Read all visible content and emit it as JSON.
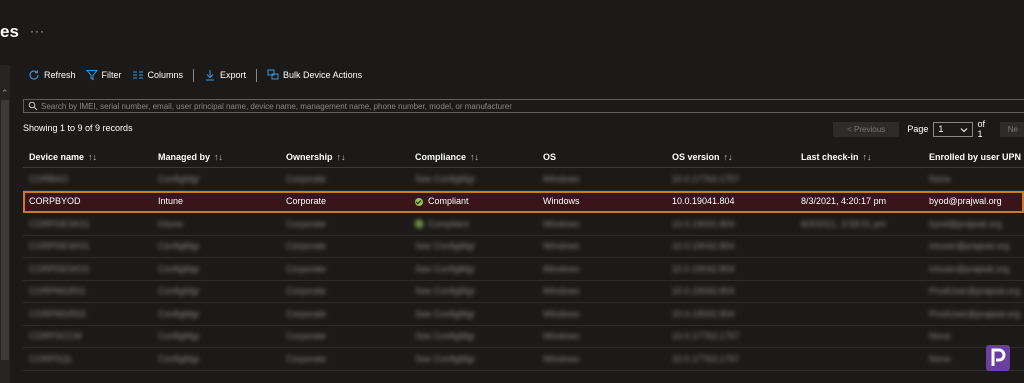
{
  "header": {
    "title": "es",
    "more": "···"
  },
  "toolbar": {
    "refresh": "Refresh",
    "filter": "Filter",
    "columns": "Columns",
    "export": "Export",
    "bulk": "Bulk Device Actions"
  },
  "search": {
    "placeholder": "Search by IMEI, serial number, email, user principal name, device name, management name, phone number, model, or manufacturer",
    "value": ""
  },
  "records": "Showing 1 to 9 of 9 records",
  "pager": {
    "previous": "< Previous",
    "page_label": "Page",
    "page_value": "1",
    "of_label": "of 1",
    "next": "Ne"
  },
  "columns": [
    {
      "label": "Device name",
      "sort": "↑↓"
    },
    {
      "label": "Managed by",
      "sort": "↑↓"
    },
    {
      "label": "Ownership",
      "sort": "↑↓"
    },
    {
      "label": "Compliance",
      "sort": "↑↓"
    },
    {
      "label": "OS",
      "sort": ""
    },
    {
      "label": "OS version",
      "sort": "↑↓"
    },
    {
      "label": "Last check-in",
      "sort": "↑↓"
    },
    {
      "label": "Enrolled by user UPN",
      "sort": "↑"
    }
  ],
  "rows": [
    {
      "blur": true,
      "selected": false,
      "cells": [
        "CORBAO",
        "ConfigMgr",
        "Corporate",
        "See ConfigMgr",
        "Windows",
        "10.0.17763.1757",
        "",
        "None"
      ],
      "compliant": false
    },
    {
      "blur": false,
      "selected": true,
      "cells": [
        "CORPBYOD",
        "Intune",
        "Corporate",
        "Compliant",
        "Windows",
        "10.0.19041.804",
        "8/3/2021, 4:20:17 pm",
        "byod@prajwal.org"
      ],
      "compliant": true
    },
    {
      "blur": true,
      "selected": false,
      "cells": [
        "CORPDESK01",
        "Intune",
        "Corporate",
        "Compliant",
        "Windows",
        "10.0.19041.804",
        "8/3/2021, 3:58:51 pm",
        "byod@prajwal.org"
      ],
      "compliant": true
    },
    {
      "blur": true,
      "selected": false,
      "cells": [
        "CORPDESK01",
        "ConfigMgr",
        "Corporate",
        "See ConfigMgr",
        "Windows",
        "10.0.19042.804",
        "",
        "intuser@prajwal.org"
      ],
      "compliant": false
    },
    {
      "blur": true,
      "selected": false,
      "cells": [
        "CORPDESK02",
        "ConfigMgr",
        "Corporate",
        "See ConfigMgr",
        "Windows",
        "10.0.19042.804",
        "",
        "intuser@prajwal.org"
      ],
      "compliant": false
    },
    {
      "blur": true,
      "selected": false,
      "cells": [
        "CORPMGR01",
        "ConfigMgr",
        "Corporate",
        "See ConfigMgr",
        "Windows",
        "10.0.19042.804",
        "",
        "ProdUser@prajwal.org"
      ],
      "compliant": false
    },
    {
      "blur": true,
      "selected": false,
      "cells": [
        "CORPMGR02",
        "ConfigMgr",
        "Corporate",
        "See ConfigMgr",
        "Windows",
        "10.0.19042.804",
        "",
        "ProdUser@prajwal.org"
      ],
      "compliant": false
    },
    {
      "blur": true,
      "selected": false,
      "cells": [
        "CORPSCCM",
        "ConfigMgr",
        "Corporate",
        "See ConfigMgr",
        "Windows",
        "10.0.17763.1757",
        "",
        "None"
      ],
      "compliant": false
    },
    {
      "blur": true,
      "selected": false,
      "cells": [
        "CORPSQL",
        "ConfigMgr",
        "Corporate",
        "See ConfigMgr",
        "Windows",
        "10.0.17763.1757",
        "",
        "None"
      ],
      "compliant": false
    }
  ],
  "colors": {
    "accent": "#3a96dd",
    "compliant": "#92c353",
    "selected_border": "#c97b2a",
    "logo": "#6b3fa0"
  }
}
